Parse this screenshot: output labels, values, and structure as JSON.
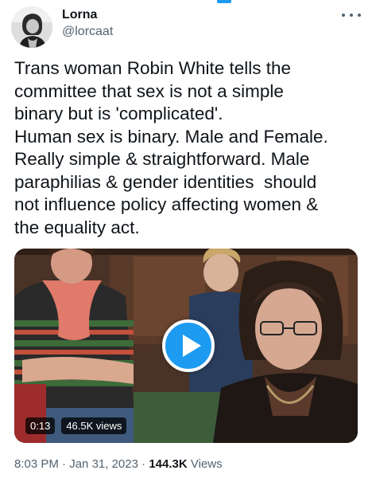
{
  "author": {
    "display_name": "Lorna",
    "handle": "@lorcaat",
    "avatar_icon": "profile-photo-icon",
    "more_icon": "more-dots-icon"
  },
  "tweet": {
    "text": "Trans woman Robin White tells the\ncommittee that sex is not a simple\nbinary but is 'complicated'.\nHuman sex is binary. Male and Female.\nReally simple & straightforward. Male\nparaphilias & gender identities  should\nnot influence policy affecting women &\nthe equality act."
  },
  "media": {
    "type": "video",
    "duration": "0:13",
    "views": "46.5K views",
    "play_icon": "play-icon"
  },
  "meta": {
    "time": "8:03 PM",
    "separator1": " · ",
    "date": "Jan 31, 2023",
    "separator2": " · ",
    "view_count": "144.3K",
    "views_label": " Views"
  },
  "colors": {
    "accent": "#1d9bf0",
    "text": "#0f1419",
    "muted": "#536471"
  }
}
